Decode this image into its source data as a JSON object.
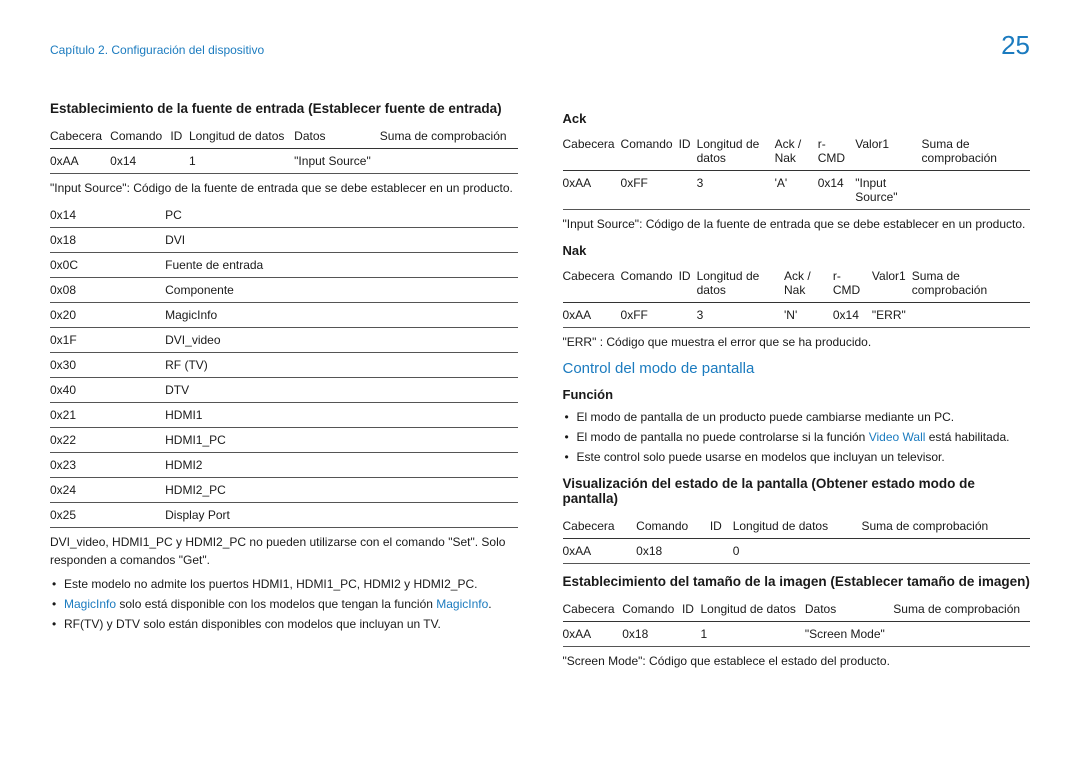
{
  "header": {
    "chapter": "Capítulo 2. Configuración del dispositivo",
    "page": "25"
  },
  "left": {
    "h2": "Establecimiento de la fuente de entrada (Establecer fuente de entrada)",
    "t1": {
      "head": [
        "Cabecera",
        "Comando",
        "ID",
        "Longitud de datos",
        "Datos",
        "Suma de comprobación"
      ],
      "row": [
        "0xAA",
        "0x14",
        "",
        "1",
        "\"Input Source\"",
        ""
      ]
    },
    "note1": "\"Input Source\": Código de la fuente de entrada que se debe establecer en un producto.",
    "t2": [
      [
        "0x14",
        "PC"
      ],
      [
        "0x18",
        "DVI"
      ],
      [
        "0x0C",
        "Fuente de entrada"
      ],
      [
        "0x08",
        "Componente"
      ],
      [
        "0x20",
        "MagicInfo"
      ],
      [
        "0x1F",
        "DVI_video"
      ],
      [
        "0x30",
        "RF (TV)"
      ],
      [
        "0x40",
        "DTV"
      ],
      [
        "0x21",
        "HDMI1"
      ],
      [
        "0x22",
        "HDMI1_PC"
      ],
      [
        "0x23",
        "HDMI2"
      ],
      [
        "0x24",
        "HDMI2_PC"
      ],
      [
        "0x25",
        "Display Port"
      ]
    ],
    "note2": "DVI_video, HDMI1_PC y HDMI2_PC no pueden utilizarse con el comando \"Set\". Solo responden a comandos \"Get\".",
    "bullets": {
      "b0": "Este modelo no admite los puertos HDMI1, HDMI1_PC, HDMI2 y HDMI2_PC.",
      "b1a": "MagicInfo",
      "b1b": " solo está disponible con los modelos que tengan la función ",
      "b1c": "MagicInfo",
      "b1d": ".",
      "b2": "RF(TV) y DTV solo están disponibles con modelos que incluyan un TV."
    }
  },
  "right": {
    "ack": {
      "title": "Ack",
      "head": [
        "Cabecera",
        "Comando",
        "ID",
        "Longitud de datos",
        "Ack / Nak",
        "r-CMD",
        "Valor1",
        "Suma de comprobación"
      ],
      "row": [
        "0xAA",
        "0xFF",
        "",
        "3",
        "'A'",
        "0x14",
        "\"Input Source\"",
        ""
      ]
    },
    "ack_note": "\"Input Source\": Código de la fuente de entrada que se debe establecer en un producto.",
    "nak": {
      "title": "Nak",
      "head": [
        "Cabecera",
        "Comando",
        "ID",
        "Longitud de datos",
        "Ack / Nak",
        "r-CMD",
        "Valor1",
        "Suma de comprobación"
      ],
      "row": [
        "0xAA",
        "0xFF",
        "",
        "3",
        "'N'",
        "0x14",
        "\"ERR\"",
        ""
      ]
    },
    "nak_note": "\"ERR\" : Código que muestra el error que se ha producido.",
    "h3": "Control del modo de pantalla",
    "funcion": {
      "title": "Función",
      "b0": "El modo de pantalla de un producto puede cambiarse mediante un PC.",
      "b1a": "El modo de pantalla no puede controlarse si la función ",
      "b1b": "Video Wall",
      "b1c": " está habilitada.",
      "b2": "Este control solo puede usarse en modelos que incluyan un televisor."
    },
    "vis": {
      "title": "Visualización del estado de la pantalla (Obtener estado modo de pantalla)",
      "head": [
        "Cabecera",
        "Comando",
        "ID",
        "Longitud de datos",
        "Suma de comprobación"
      ],
      "row": [
        "0xAA",
        "0x18",
        "",
        "0",
        ""
      ]
    },
    "est": {
      "title": "Establecimiento del tamaño de la imagen (Establecer tamaño de imagen)",
      "head": [
        "Cabecera",
        "Comando",
        "ID",
        "Longitud de datos",
        "Datos",
        "Suma de comprobación"
      ],
      "row": [
        "0xAA",
        "0x18",
        "",
        "1",
        "\"Screen Mode\"",
        ""
      ]
    },
    "est_note": "\"Screen Mode\": Código que establece el estado del producto."
  }
}
